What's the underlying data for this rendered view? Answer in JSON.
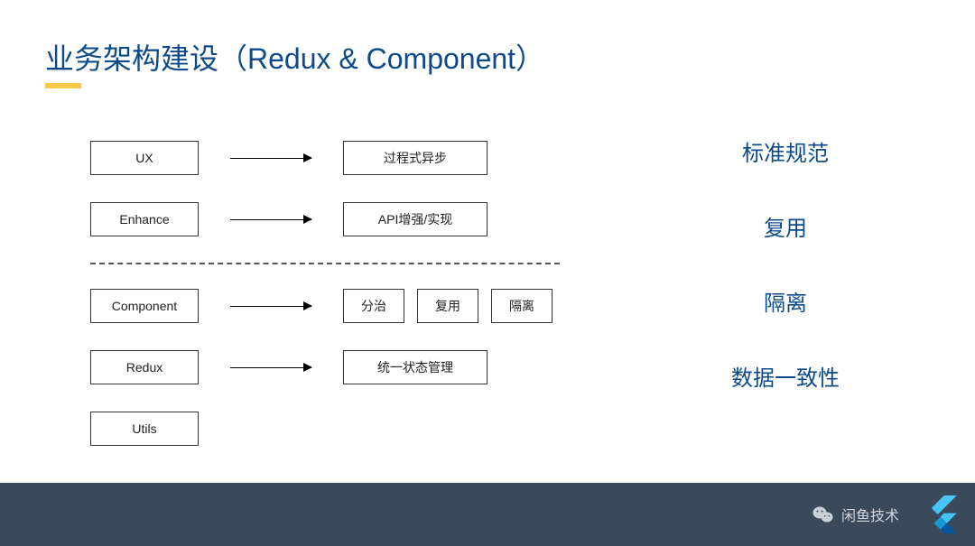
{
  "title": "业务架构建设（Redux & Component）",
  "rows": {
    "ux": {
      "left": "UX",
      "right": "过程式异步"
    },
    "enhance": {
      "left": "Enhance",
      "right": "API增强/实现"
    },
    "component": {
      "left": "Component",
      "cells": [
        "分治",
        "复用",
        "隔离"
      ]
    },
    "redux": {
      "left": "Redux",
      "right": "统一状态管理"
    },
    "utils": {
      "left": "Utils"
    }
  },
  "rightLabels": [
    "标准规范",
    "复用",
    "隔离",
    "数据一致性"
  ],
  "footer": {
    "brand": "闲鱼技术"
  }
}
